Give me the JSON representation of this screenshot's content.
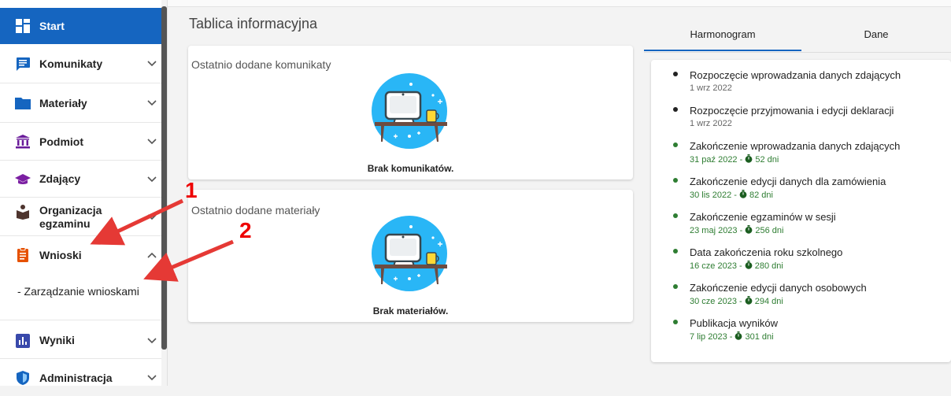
{
  "sidebar": {
    "items": [
      {
        "label": "Start",
        "icon": "dashboard-icon"
      },
      {
        "label": "Komunikaty",
        "icon": "message-icon"
      },
      {
        "label": "Materiały",
        "icon": "folder-icon"
      },
      {
        "label": "Podmiot",
        "icon": "institution-icon"
      },
      {
        "label": "Zdający",
        "icon": "graduation-cap-icon"
      },
      {
        "label": "Organizacja",
        "label2": "egzaminu",
        "icon": "organization-icon"
      },
      {
        "label": "Wnioski",
        "icon": "document-icon"
      },
      {
        "label": "Wyniki",
        "icon": "bar-chart-icon"
      },
      {
        "label": "Administracja",
        "icon": "shield-icon"
      }
    ],
    "sub_item": "- Zarządzanie wnioskami"
  },
  "main": {
    "title": "Tablica informacyjna",
    "cards": [
      {
        "title": "Ostatnio dodane komunikaty",
        "empty": "Brak komunikatów."
      },
      {
        "title": "Ostatnio dodane materiały",
        "empty": "Brak materiałów."
      }
    ]
  },
  "annotations": {
    "one": "1",
    "two": "2"
  },
  "tabs": {
    "schedule": "Harmonogram",
    "data": "Dane"
  },
  "schedule": [
    {
      "name": "Rozpoczęcie wprowadzania danych zdających",
      "date": "1 wrz 2022",
      "days": "",
      "status": "past"
    },
    {
      "name": "Rozpoczęcie przyjmowania i edycji deklaracji",
      "date": "1 wrz 2022",
      "days": "",
      "status": "past"
    },
    {
      "name": "Zakończenie wprowadzania danych zdających",
      "date": "31 paź 2022 - ",
      "days": "52 dni",
      "status": "upcoming"
    },
    {
      "name": "Zakończenie edycji danych dla zamówienia",
      "date": "30 lis 2022 - ",
      "days": "82 dni",
      "status": "upcoming"
    },
    {
      "name": "Zakończenie egzaminów w sesji",
      "date": "23 maj 2023 - ",
      "days": "256 dni",
      "status": "upcoming"
    },
    {
      "name": "Data zakończenia roku szkolnego",
      "date": "16 cze 2023 - ",
      "days": "280 dni",
      "status": "upcoming"
    },
    {
      "name": "Zakończenie edycji danych osobowych",
      "date": "30 cze 2023 - ",
      "days": "294 dni",
      "status": "upcoming"
    },
    {
      "name": "Publikacja wyników",
      "date": "7 lip 2023 - ",
      "days": "301 dni",
      "status": "upcoming"
    }
  ],
  "colors": {
    "primary": "#1565c0",
    "green": "#2e7d32",
    "arrow": "#e53935",
    "illustration": "#29b6f6"
  }
}
